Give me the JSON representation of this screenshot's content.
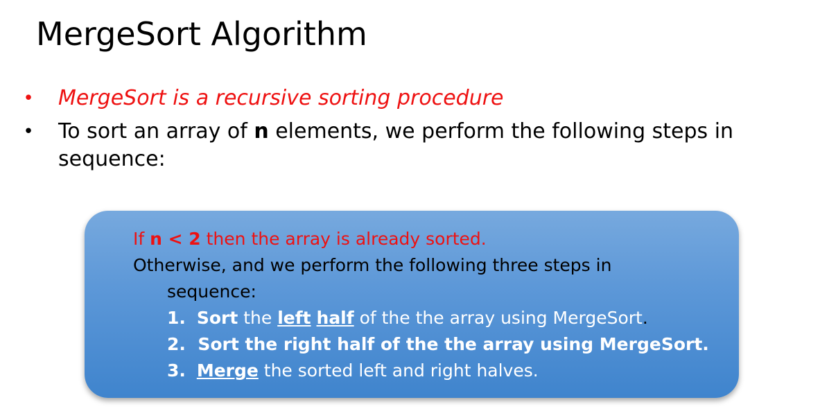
{
  "slide": {
    "title": "MergeSort Algorithm"
  },
  "bullets": [
    {
      "text": "MergeSort is a recursive sorting procedure"
    },
    {
      "prefix": "To sort an array of ",
      "bold": "n",
      "suffix": " elements, we perform the following steps in sequence:"
    }
  ],
  "box": {
    "line1": {
      "prefix": "If ",
      "bold": "n < 2",
      "suffix": " then the array is already sorted."
    },
    "line2": "Otherwise, and we perform the following three steps in",
    "line3": "sequence:",
    "steps": [
      {
        "num": "1.",
        "bold": "Sort",
        "mid1": " the ",
        "u1": "left",
        "mid2": " ",
        "u2": "half",
        "rest": " of the the array using MergeSort",
        "end": "."
      },
      {
        "num": "2.",
        "text": "Sort the right half of the the array using MergeSort."
      },
      {
        "num": "3.",
        "bold": "Merge",
        "rest": " the sorted left and right halves."
      }
    ]
  },
  "colors": {
    "accent_red": "#ee1111",
    "box_blue_top": "#77a9de",
    "box_blue_bottom": "#3f84cd"
  }
}
